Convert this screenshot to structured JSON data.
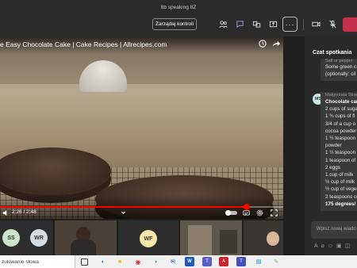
{
  "window": {
    "title": "8b speaking 8Z"
  },
  "toolbar": {
    "share_control_label": "Zarządaj kontroli",
    "icons": [
      "people-icon",
      "chat-icon",
      "breakout-rooms-icon",
      "share-tray-icon",
      "more-icon",
      "camera-icon",
      "mic-icon",
      "share-icon",
      "leave-icon"
    ]
  },
  "video": {
    "title": "e Easy Chocolate Cake | Cake Recipes | Allrecipes.com",
    "time_display": "2:26 / 2:48",
    "progress": 0.87
  },
  "participants": [
    {
      "initials": "SS",
      "color": "#c9e5c9"
    },
    {
      "initials": "WR",
      "color": "#d4dde3"
    },
    {
      "initials": "WF",
      "color": "#f5e6a8"
    }
  ],
  "chat": {
    "title": "Czat spotkania",
    "prev_message_lines": [
      "Salt or pepper",
      "Some green c",
      "(optionally: cil"
    ],
    "author_initials": "MS",
    "author_name": "Małgorzata Strad",
    "message_title": "Chocolate cak",
    "message_lines": [
      "2 cups of suga",
      "1 ¾ cups of fl",
      "3/4 of a cup o",
      "cocoa powder",
      "1 ½ teaspoon",
      "powder",
      "1 ½ teaspoon",
      "1 teaspoon of",
      "2 eggs",
      "1 cup of milk",
      "½ cup of milk",
      "½ cup of vege",
      "2 teaspoons o"
    ],
    "message_last_line": "175 degrees/",
    "compose_placeholder": "Wpisz nową wiado"
  },
  "taskbar": {
    "search_placeholder": "zukiwanie słowa",
    "apps": [
      "task-view-icon",
      "edge-icon",
      "explorer-icon",
      "chrome-icon",
      "edge-2-icon",
      "mail-icon",
      "word-icon",
      "teams-icon",
      "acrobat-icon",
      "teams-2-icon",
      "store-icon",
      "notes-icon"
    ]
  }
}
